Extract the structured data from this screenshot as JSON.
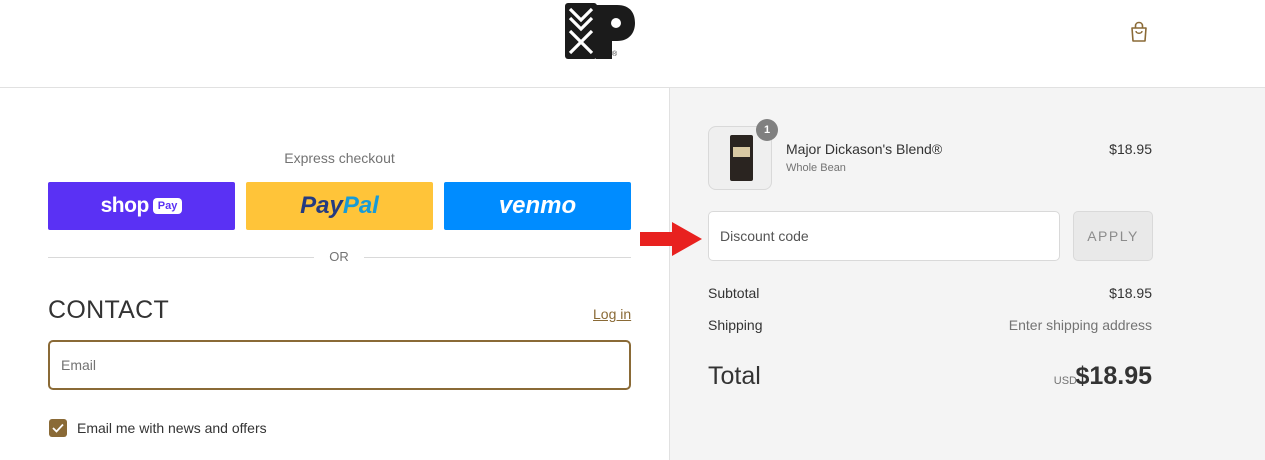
{
  "header": {
    "logo_icon": "brand-monogram-icon",
    "reg_mark": "®",
    "cart_icon": "shopping-bag-icon"
  },
  "express": {
    "label": "Express checkout",
    "shop_pay": {
      "word": "shop",
      "pill": "Pay",
      "color": "#5a31f4"
    },
    "paypal": {
      "part1": "Pay",
      "part2": "Pal",
      "color": "#ffc439"
    },
    "venmo": {
      "word": "venmo",
      "color": "#008cff"
    },
    "divider_text": "OR"
  },
  "contact": {
    "title": "CONTACT",
    "login_link": "Log in",
    "email_placeholder": "Email",
    "newsletter_label": "Email me with news and offers",
    "newsletter_checked": true,
    "accent_color": "#8a6a36"
  },
  "order": {
    "item": {
      "name": "Major Dickason's Blend®",
      "variant": "Whole Bean",
      "price": "$18.95",
      "quantity": "1"
    },
    "discount": {
      "placeholder": "Discount code",
      "apply_label": "APPLY"
    },
    "subtotal": {
      "label": "Subtotal",
      "value": "$18.95"
    },
    "shipping": {
      "label": "Shipping",
      "value": "Enter shipping address"
    },
    "total": {
      "label": "Total",
      "currency": "USD",
      "value": "$18.95"
    }
  },
  "annotation": {
    "arrow_color": "#e8211f",
    "arrow_icon": "red-arrow-right-icon"
  }
}
